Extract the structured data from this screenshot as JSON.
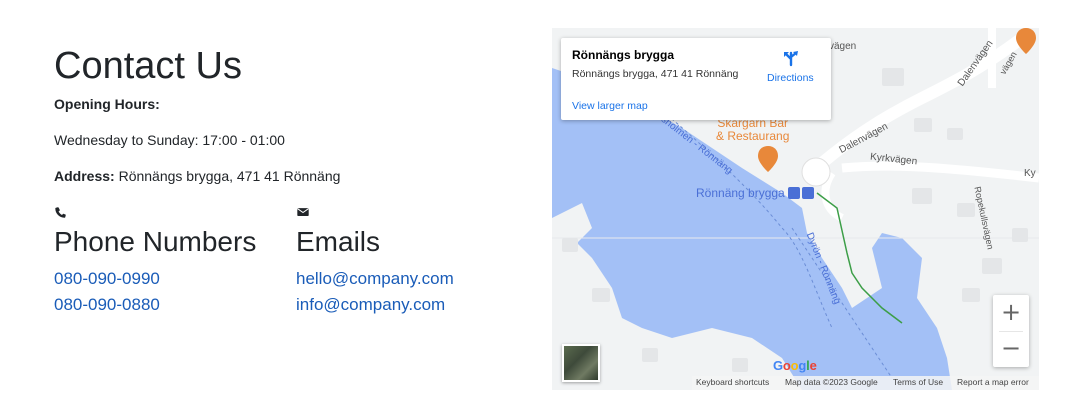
{
  "contact": {
    "title": "Contact Us",
    "hours_heading": "Opening Hours:",
    "hours_text": "Wednesday to Sunday: 17:00 - 01:00",
    "address_label": "Address:",
    "address_value": "Rönnängs brygga, 471 41 Rönnäng"
  },
  "phones": {
    "heading": "Phone Numbers",
    "icon": "phone-icon",
    "numbers": [
      "080-090-0990",
      "080-090-0880"
    ]
  },
  "emails": {
    "heading": "Emails",
    "icon": "envelope-icon",
    "addresses": [
      "hello@company.com",
      "info@company.com"
    ]
  },
  "map": {
    "place_name": "Rönnängs brygga",
    "place_address": "Rönnängs brygga, 471 41 Rönnäng",
    "directions_label": "Directions",
    "larger_map_link": "View larger map",
    "labels": {
      "restaurant": "Skärgårn Bar\n& Restaurang",
      "restaurant_line1": "Skärgårn Bar",
      "restaurant_line2": "& Restaurang",
      "ferry_stop": "Rönnäng brygga",
      "street_dalenvagen_top": "Dalenvägen",
      "street_dalenvagen_mid": "Dalenvägen",
      "street_kyrkvagen": "Kyrkvägen",
      "street_ropekullsvagen": "Ropekullsvägen",
      "route_holmen": "esholmen - Rönnäng",
      "route_dyron": "Dyrön - Rönnäng",
      "partial_vagen": "vägen",
      "partial_ky": "Ky",
      "partial_vagen2": "vägen"
    },
    "zoom_in": "+",
    "zoom_out": "−",
    "google_logo": "Google",
    "footer": {
      "keyboard": "Keyboard shortcuts",
      "map_data": "Map data ©2023 Google",
      "terms": "Terms of Use",
      "report": "Report a map error"
    },
    "colors": {
      "water": "#a3c0f6",
      "land": "#f1f3f4",
      "link": "#1a5cb8",
      "poi_orange": "#e8883a",
      "ferry_blue": "#4a6fd6"
    }
  }
}
